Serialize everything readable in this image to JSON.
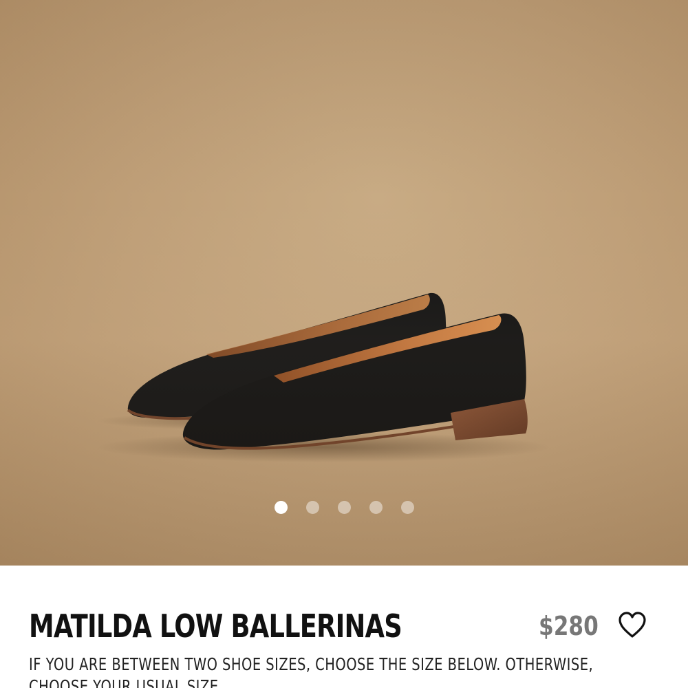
{
  "product": {
    "title": "MATILDA LOW BALLERINAS",
    "price": "$280",
    "size_note": "IF YOU ARE BETWEEN TWO SHOE SIZES, CHOOSE THE SIZE BELOW. OTHERWISE, CHOOSE YOUR USUAL SIZE."
  },
  "gallery": {
    "image_count": 5,
    "active_index": 0
  },
  "icons": {
    "wishlist": "heart-icon"
  },
  "colors": {
    "background": "#c3a47d",
    "shoe": "#0f0f0f",
    "lining": "#b3672f",
    "heel": "#7a4529",
    "title": "#111111",
    "price": "#777777"
  }
}
